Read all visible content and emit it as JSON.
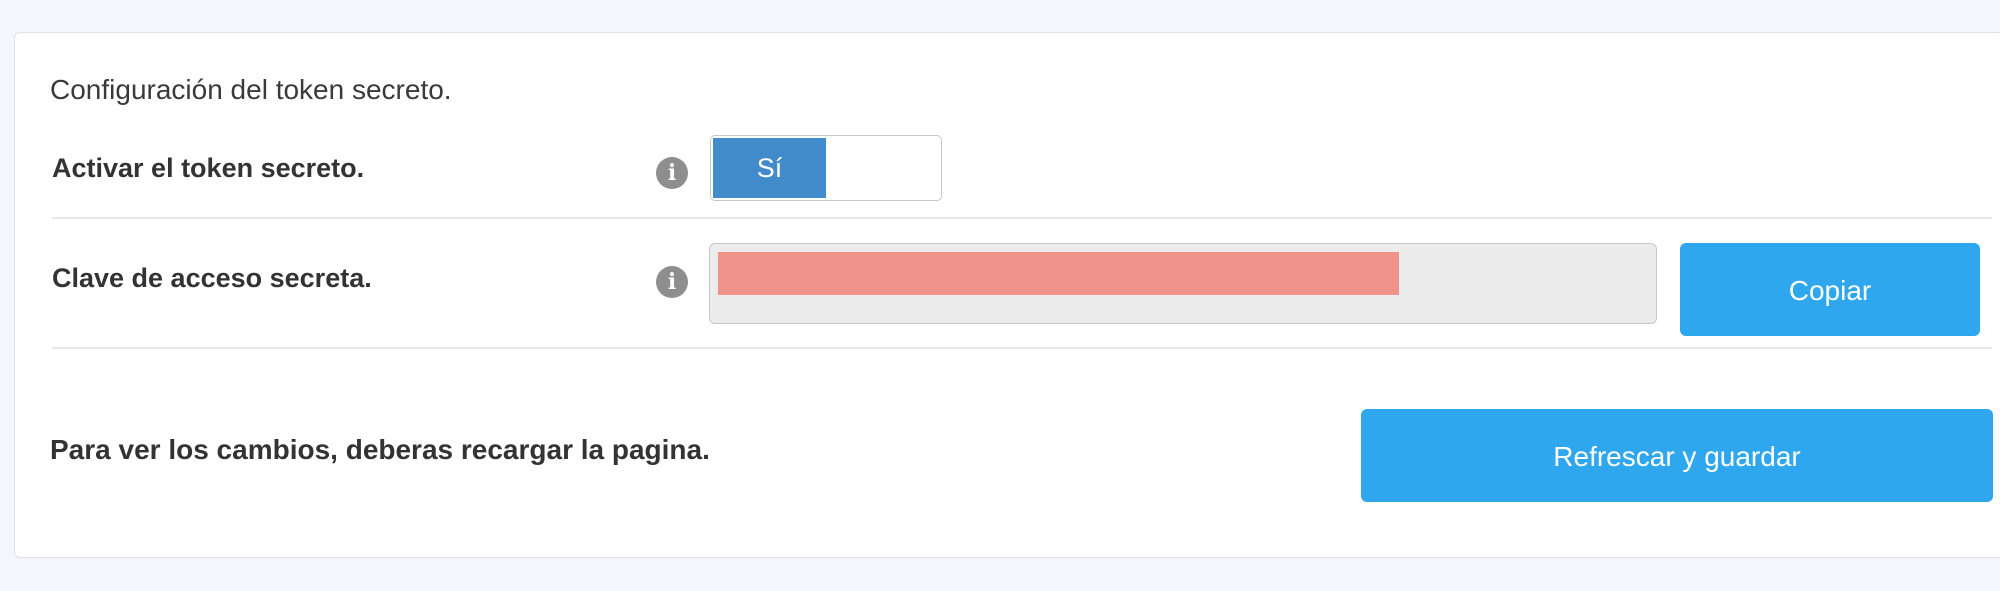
{
  "section": {
    "heading": "Configuración del token secreto."
  },
  "enable_row": {
    "label": "Activar el token secreto.",
    "info_icon": "info-circle-icon",
    "toggle": {
      "on_label": "Sí",
      "state": "on"
    }
  },
  "secret_row": {
    "label": "Clave de acceso secreta.",
    "info_icon": "info-circle-icon",
    "value_redacted": true,
    "copy_label": "Copiar"
  },
  "footer": {
    "notice": "Para ver los cambios, deberas recargar la pagina.",
    "refresh_label": "Refrescar y guardar"
  },
  "colors": {
    "toggle_active": "#428bca",
    "button_primary": "#2ea7ee",
    "redaction": "#f0938a",
    "info_icon": "#8e8e8e",
    "field_background": "#ececec"
  }
}
